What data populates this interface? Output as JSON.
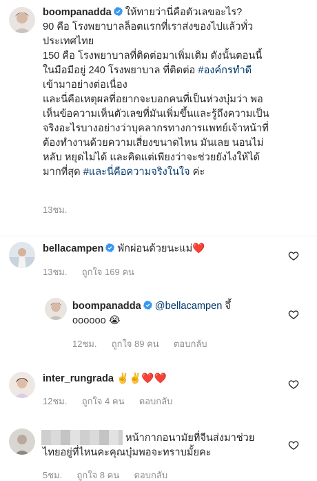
{
  "post_caption": {
    "username": "boompanadda",
    "line1_rest": "ให้ทายว่านี่คือตัวเลขอะไร?",
    "line2": "90 คือ โรงพยาบาลล็อตแรกที่เราส่งของไปแล้วทั่ว",
    "line3": "ประเทศไทย",
    "line4": "150 คือ โรงพยาบาลที่ติดต่อมาเพิ่มเติม ดังนั้นตอนนี้",
    "line5_a": "ในมือมีอยู่ 240 โรงพยาบาล ที่ติดต่อ ",
    "line5_tag": "#องค์กรทำดี",
    "line6": "เข้ามาอย่างต่อเนื่อง",
    "line7": "และนี่คือเหตุผลที่อยากจะบอกคนที่เป็นห่วงบุ๋มว่า พอ",
    "line8": "เห็นข้อความเห็นตัวเลขที่มันเพิ่มขึ้นและรู้ถึงความเป็น",
    "line9": "จริงอะไรบางอย่างว่าบุคลากรทางการแพทย์เจ้าหน้าที่",
    "line10": "ต้องทำงานด้วยความเสี่ยงขนาดไหน มันเลย นอนไม่",
    "line11": "หลับ หยุดไม่ได้ และคิดแต่เพียงว่าจะช่วยยังไงให้ได้",
    "line12_a": "มากที่สุด ",
    "line12_tag": "#และนี่คือความจริงในใจ",
    "line12_b": " ค่ะ",
    "time": "13ชม."
  },
  "comments": [
    {
      "username": "bellacampen",
      "text": "พักผ่อนด้วยนะแม่",
      "emoji": "❤️",
      "time": "13ชม.",
      "likes": "ถูกใจ 169 คน"
    },
    {
      "username": "boompanadda",
      "mention": "@bellacampen",
      "text_a": " จึ้",
      "text_b": "oooooo ",
      "emoji": "😭",
      "time": "12ชม.",
      "likes": "ถูกใจ 89 คน",
      "reply": "ตอบกลับ"
    },
    {
      "username": "inter_rungrada",
      "emoji": "✌️✌️❤️❤️",
      "time": "12ชม.",
      "likes": "ถูกใจ 4 คน",
      "reply": "ตอบกลับ"
    },
    {
      "line1": "หน้ากากอนามัยที่จีนส่งมาช่วย",
      "line2": "ไทยอยู่ที่ไหนคะคุณบุ๋มพอจะทราบมั้ยคะ",
      "time": "5ชม.",
      "likes": "ถูกใจ 8 คน",
      "reply": "ตอบกลับ"
    }
  ],
  "colors": {
    "text": "#262626",
    "muted": "#8e8e8e",
    "hashtag": "#00376b",
    "verified": "#3897f0",
    "heart": "#ed4956"
  },
  "icons": {
    "verified": "verified-badge-icon",
    "like": "heart-outline-icon"
  }
}
